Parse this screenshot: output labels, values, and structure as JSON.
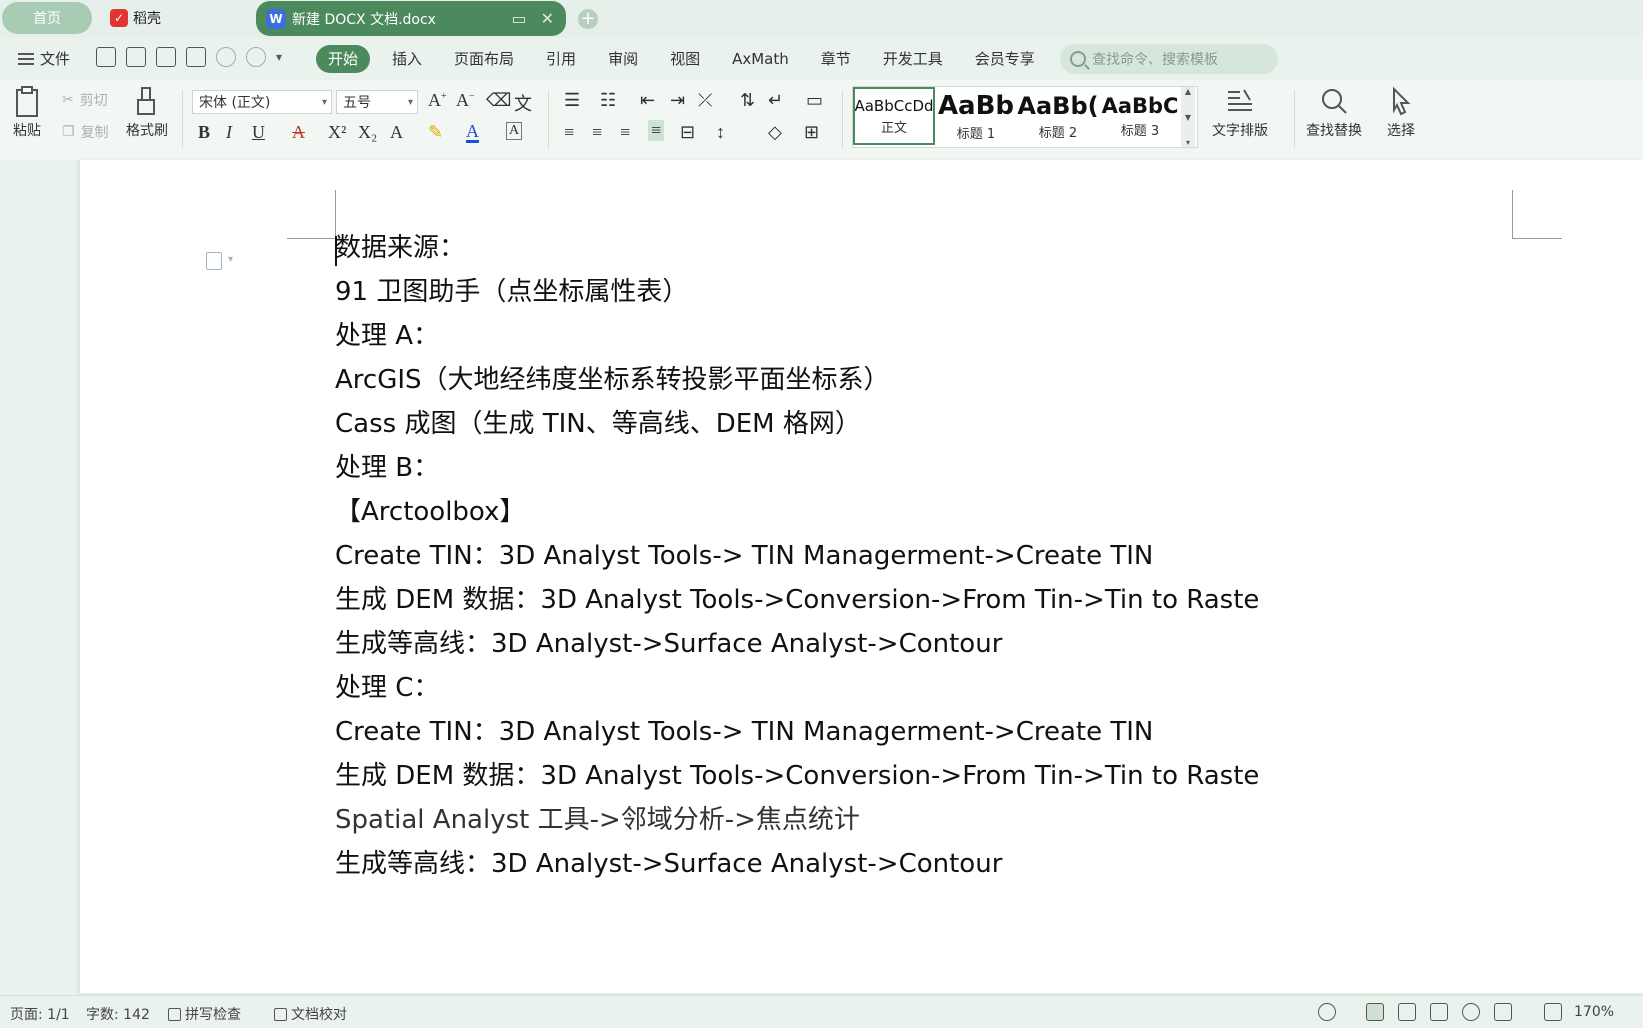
{
  "tabs": {
    "home": "首页",
    "daoke": "稻壳",
    "document": "新建 DOCX 文档.docx"
  },
  "menu": {
    "file": "文件",
    "tabs": [
      "开始",
      "插入",
      "页面布局",
      "引用",
      "审阅",
      "视图",
      "AxMath",
      "章节",
      "开发工具",
      "会员专享"
    ],
    "search_placeholder": "查找命令、搜索模板"
  },
  "ribbon": {
    "paste": "粘贴",
    "cut": "剪切",
    "copy": "复制",
    "format_painter": "格式刷",
    "font_name": "宋体 (正文)",
    "font_size": "五号",
    "styles": [
      {
        "sample": "AaBbCcDd",
        "label": "正文"
      },
      {
        "sample": "AaBb",
        "label": "标题 1"
      },
      {
        "sample": "AaBb(",
        "label": "标题 2"
      },
      {
        "sample": "AaBbC",
        "label": "标题 3"
      }
    ],
    "text_layout": "文字排版",
    "find_replace": "查找替换",
    "select": "选择"
  },
  "document": {
    "lines": [
      "数据来源：",
      "91 卫图助手（点坐标属性表）",
      "处理 A：",
      "ArcGIS（大地经纬度坐标系转投影平面坐标系）",
      "Cass 成图（生成 TIN、等高线、DEM 格网）",
      "处理 B：",
      "【Arctoolbox】",
      "Create TIN：3D Analyst Tools-> TIN Managerment->Create TIN",
      "生成 DEM 数据：3D Analyst Tools->Conversion->From Tin->Tin to Raste",
      "生成等高线：3D Analyst->Surface Analyst->Contour",
      "处理 C：",
      "Create TIN：3D Analyst Tools-> TIN Managerment->Create TIN",
      "生成 DEM 数据：3D Analyst Tools->Conversion->From Tin->Tin to Raste",
      "Spatial Analyst  工具->邻域分析->焦点统计",
      "生成等高线：3D Analyst->Surface Analyst->Contour"
    ]
  },
  "status": {
    "page": "页面: 1/1",
    "word_count": "字数: 142",
    "spell_check": "拼写检查",
    "doc_proof": "文档校对",
    "zoom": "170%"
  }
}
